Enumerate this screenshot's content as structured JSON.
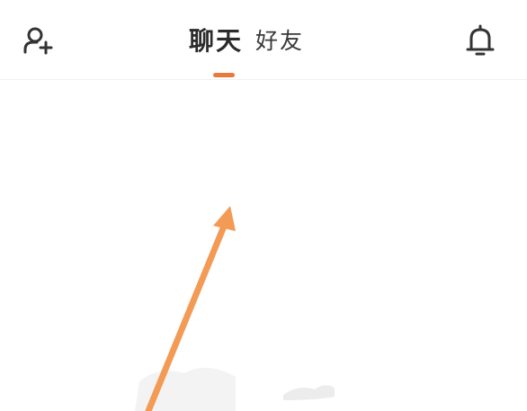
{
  "header": {
    "tabs": [
      {
        "label": "聊天",
        "active": true
      },
      {
        "label": "好友",
        "active": false
      }
    ],
    "left_icon": "add-contact-icon",
    "right_icon": "bell-icon",
    "accent_color": "#e8793a"
  },
  "content": {
    "guide_arrow_color": "#f39a55"
  }
}
